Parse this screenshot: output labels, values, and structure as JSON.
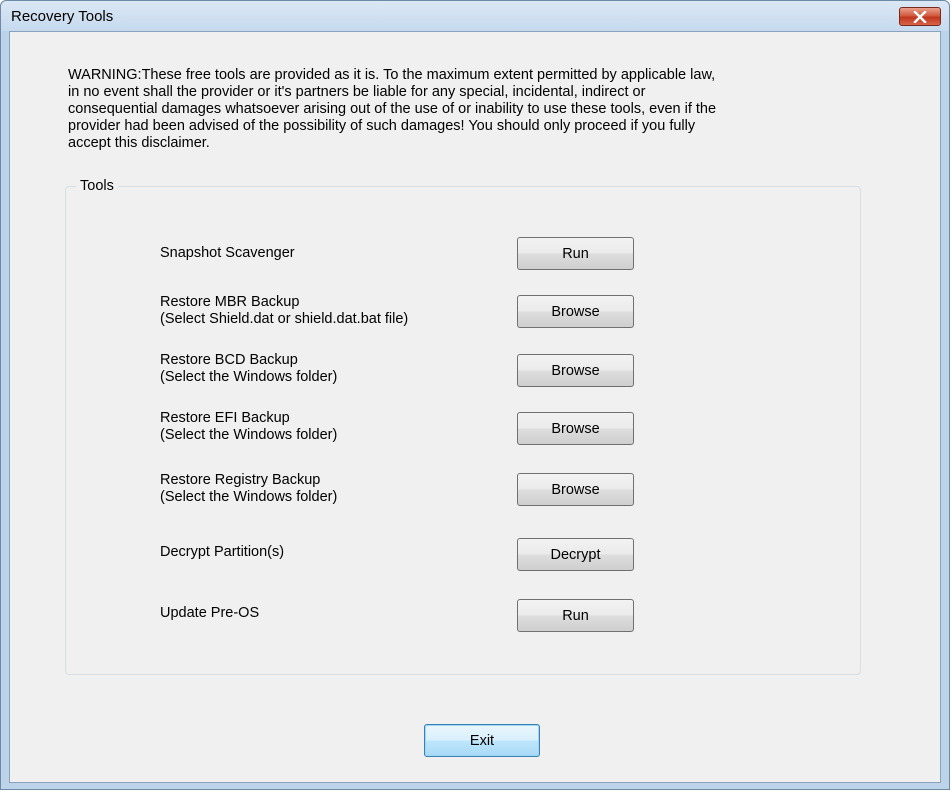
{
  "window": {
    "title": "Recovery Tools",
    "close_icon": "close-icon"
  },
  "warning_text": "WARNING:These free tools are provided as it is. To the maximum extent permitted by applicable law,\nin no event shall the provider or it's partners be liable for any special, incidental, indirect or\nconsequential damages whatsoever arising out of the use of or inability to use these tools, even if the\nprovider had been advised of the possibility of such damages! You should only proceed if you fully\naccept this disclaimer.",
  "tools_group": {
    "label": "Tools",
    "items": [
      {
        "label": "Snapshot Scavenger",
        "button": "Run"
      },
      {
        "label": "Restore MBR Backup\n(Select Shield.dat or shield.dat.bat file)",
        "button": "Browse"
      },
      {
        "label": "Restore BCD Backup\n(Select the Windows folder)",
        "button": "Browse"
      },
      {
        "label": "Restore EFI Backup\n(Select the Windows folder)",
        "button": "Browse"
      },
      {
        "label": "Restore Registry Backup\n(Select the Windows folder)",
        "button": "Browse"
      },
      {
        "label": "Decrypt Partition(s)",
        "button": "Decrypt"
      },
      {
        "label": "Update Pre-OS",
        "button": "Run"
      }
    ]
  },
  "exit_label": "Exit",
  "colors": {
    "frame": "#bcd3ea",
    "client": "#f0f0f0",
    "close_button": "#c0381d",
    "default_button_border": "#3c7fb1"
  }
}
